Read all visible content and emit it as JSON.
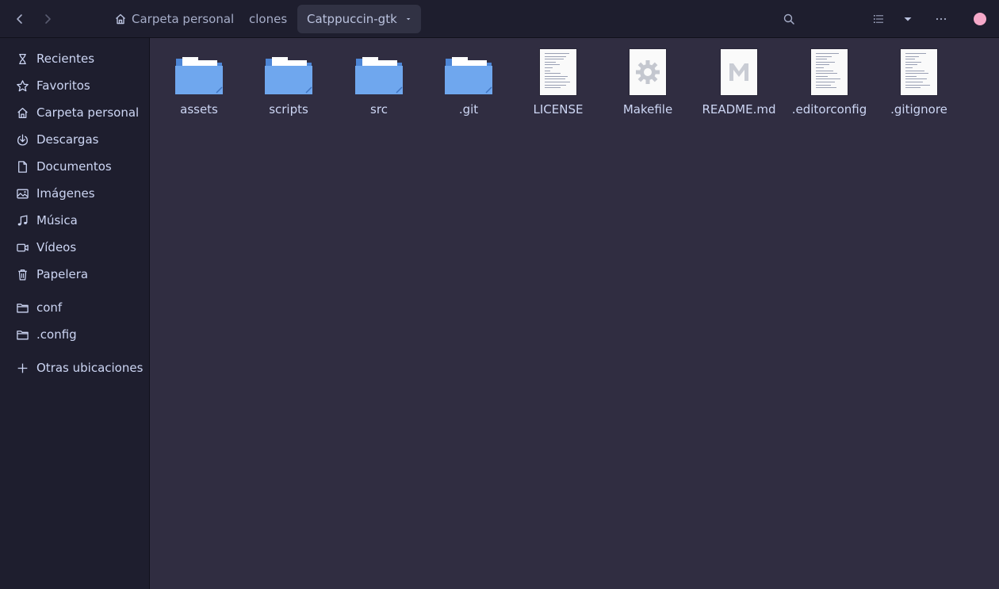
{
  "header": {
    "back_label": "back",
    "forward_label": "forward",
    "breadcrumbs": [
      "Carpeta personal",
      "clones",
      "Catppuccin-gtk"
    ],
    "close_color": "#f5a9c9"
  },
  "sidebar": {
    "items": [
      {
        "label": "Recientes",
        "icon": "clock-icon"
      },
      {
        "label": "Favoritos",
        "icon": "star-icon"
      },
      {
        "label": "Carpeta personal",
        "icon": "home-icon"
      },
      {
        "label": "Descargas",
        "icon": "download-icon"
      },
      {
        "label": "Documentos",
        "icon": "document-icon"
      },
      {
        "label": "Imágenes",
        "icon": "image-icon"
      },
      {
        "label": "Música",
        "icon": "music-icon"
      },
      {
        "label": "Vídeos",
        "icon": "video-icon"
      },
      {
        "label": "Papelera",
        "icon": "trash-icon"
      }
    ],
    "bookmarks": [
      {
        "label": "conf",
        "icon": "folder-icon"
      },
      {
        "label": ".config",
        "icon": "folder-icon"
      }
    ],
    "other_locations": "Otras ubicaciones"
  },
  "files": [
    {
      "name": "assets",
      "type": "folder"
    },
    {
      "name": "scripts",
      "type": "folder"
    },
    {
      "name": "src",
      "type": "folder"
    },
    {
      "name": ".git",
      "type": "folder"
    },
    {
      "name": "LICENSE",
      "type": "text"
    },
    {
      "name": "Makefile",
      "type": "makefile"
    },
    {
      "name": "README.md",
      "type": "markdown"
    },
    {
      "name": ".editorconfig",
      "type": "text"
    },
    {
      "name": ".gitignore",
      "type": "text"
    }
  ],
  "colors": {
    "folder": "#6fa7ee",
    "background": "#302d41",
    "sidebar": "#1e1e2e"
  }
}
